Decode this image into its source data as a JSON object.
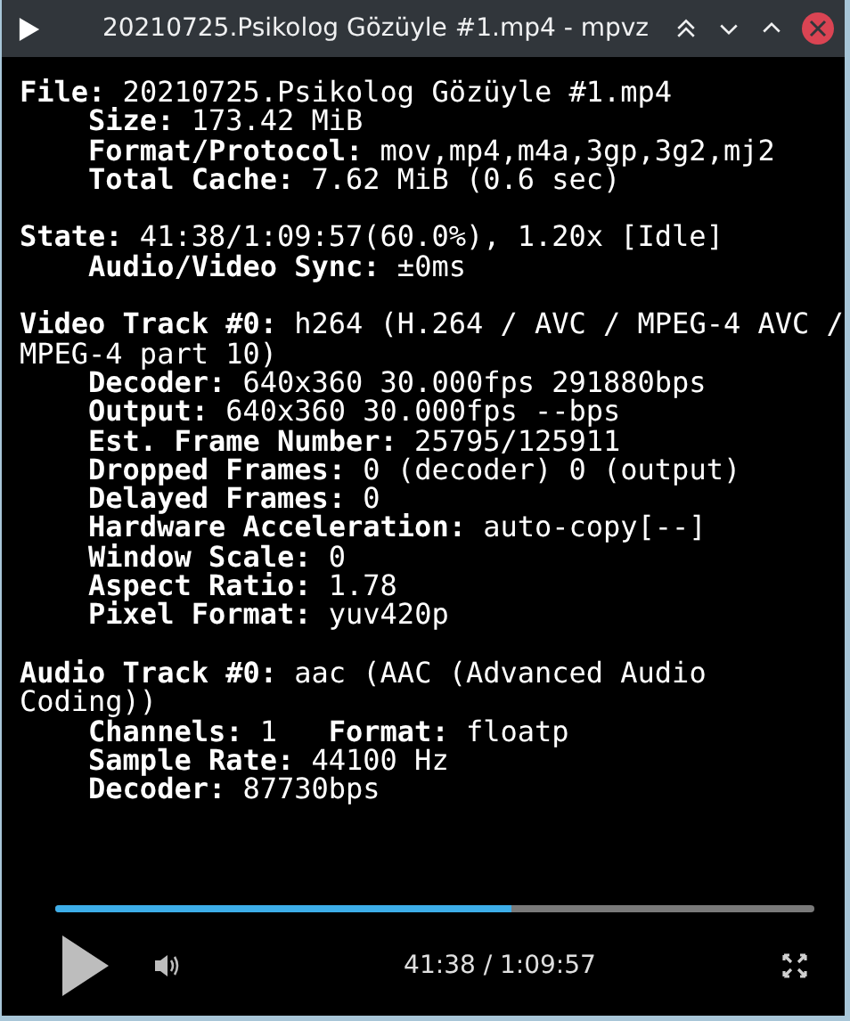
{
  "window": {
    "title": "20210725.Psikolog Gözüyle #1.mp4 - mpvz"
  },
  "stats": [
    {
      "header": [
        {
          "key": "File:",
          "value": "20210725.Psikolog Gözüyle #1.mp4"
        }
      ],
      "items": [
        [
          {
            "key": "Size:",
            "value": "173.42 MiB"
          }
        ],
        [
          {
            "key": "Format/Protocol:",
            "value": "mov,mp4,m4a,3gp,3g2,mj2"
          }
        ],
        [
          {
            "key": "Total Cache:",
            "value": "7.62 MiB (0.6 sec)"
          }
        ]
      ]
    },
    {
      "header": [
        {
          "key": "State:",
          "value": "41:38/1:09:57(60.0%), 1.20x [Idle]"
        }
      ],
      "items": [
        [
          {
            "key": "Audio/Video Sync:",
            "value": "±0ms"
          }
        ]
      ]
    },
    {
      "header": [
        {
          "key": "Video Track #0:",
          "value": "h264 (H.264 / AVC / MPEG-4 AVC / MPEG-4 part 10)"
        }
      ],
      "items": [
        [
          {
            "key": "Decoder:",
            "value": "640x360 30.000fps 291880bps"
          }
        ],
        [
          {
            "key": "Output:",
            "value": "640x360 30.000fps --bps"
          }
        ],
        [
          {
            "key": "Est. Frame Number:",
            "value": "25795/125911"
          }
        ],
        [
          {
            "key": "Dropped Frames:",
            "value": "0 (decoder) 0 (output)"
          }
        ],
        [
          {
            "key": "Delayed Frames:",
            "value": "0"
          }
        ],
        [
          {
            "key": "Hardware Acceleration:",
            "value": "auto-copy[--]"
          }
        ],
        [
          {
            "key": "Window Scale:",
            "value": "0"
          }
        ],
        [
          {
            "key": "Aspect Ratio:",
            "value": "1.78"
          }
        ],
        [
          {
            "key": "Pixel Format:",
            "value": "yuv420p"
          }
        ]
      ]
    },
    {
      "header": [
        {
          "key": "Audio Track #0:",
          "value": "aac (AAC (Advanced Audio Coding))"
        }
      ],
      "items": [
        [
          {
            "key": "Channels:",
            "value": "1"
          },
          {
            "key": "Format:",
            "value": "floatp"
          }
        ],
        [
          {
            "key": "Sample Rate:",
            "value": "44100 Hz"
          }
        ],
        [
          {
            "key": "Decoder:",
            "value": "87730bps"
          }
        ]
      ]
    }
  ],
  "playback": {
    "level": 0.6,
    "time": "41:38 / 1:09:57"
  }
}
